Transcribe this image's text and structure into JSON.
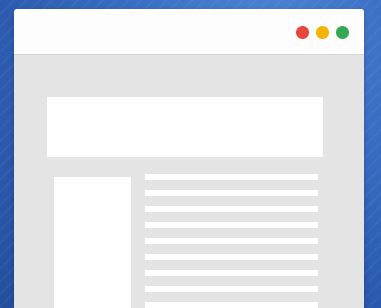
{
  "colors": {
    "background": "#3a6fc4",
    "window_body": "#e4e4e4",
    "titlebar": "#fdfdfd",
    "placeholder_block": "#ffffff",
    "close_dot": "#e8453c",
    "minimize_dot": "#f5b400",
    "maximize_dot": "#34a853"
  },
  "window_controls": [
    {
      "name": "close-dot",
      "icon": "red-circle"
    },
    {
      "name": "minimize-dot",
      "icon": "yellow-circle"
    },
    {
      "name": "maximize-dot",
      "icon": "green-circle"
    }
  ],
  "content": {
    "text_line_count": 9
  }
}
